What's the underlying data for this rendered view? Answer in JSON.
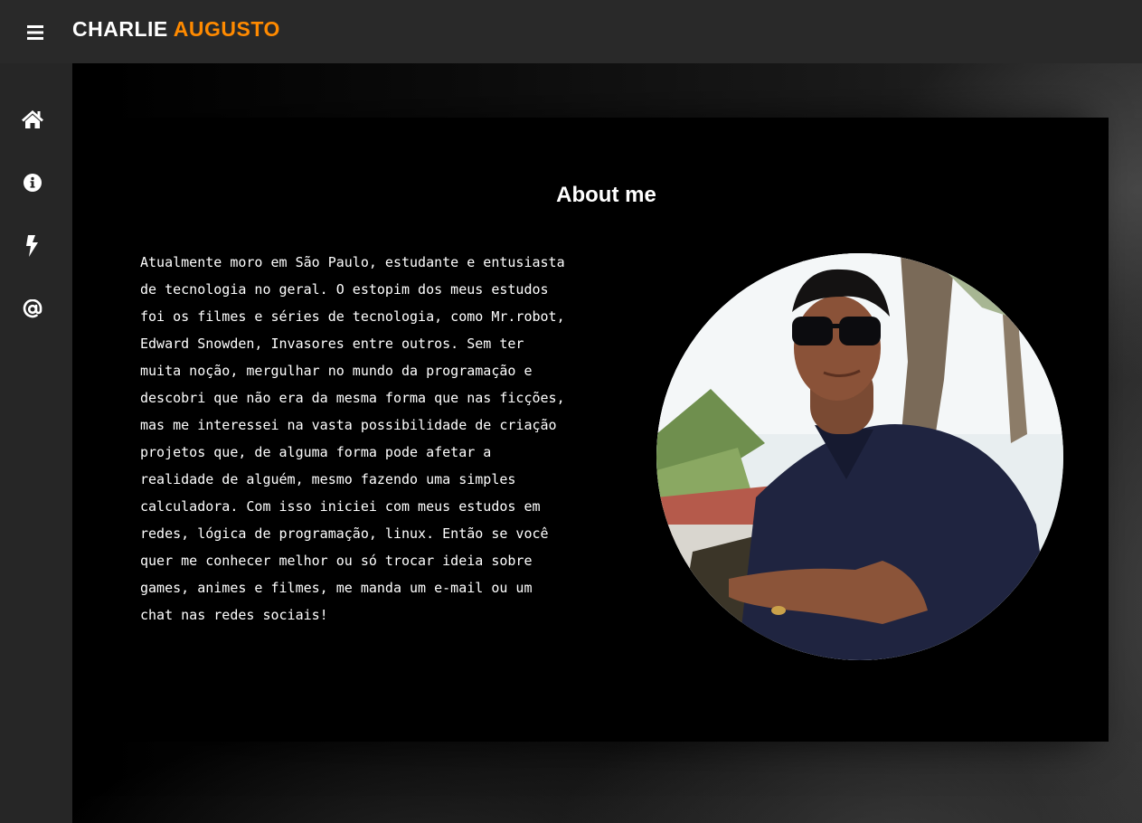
{
  "header": {
    "menu_icon": "hamburger-icon",
    "brand_first": "CHARLIE",
    "brand_second": "AUGUSTO",
    "brand_accent_color": "#ff8a00"
  },
  "sidebar": {
    "items": [
      {
        "icon": "home-icon"
      },
      {
        "icon": "info-icon"
      },
      {
        "icon": "bolt-icon"
      },
      {
        "icon": "at-icon"
      }
    ]
  },
  "about": {
    "title": "About me",
    "text": "Atualmente moro em São Paulo, estudante e entusiasta de tecnologia no geral. O estopim dos meus estudos foi os filmes e séries de tecnologia, como Mr.robot, Edward Snowden, Invasores entre outros. Sem ter muita noção, mergulhar no mundo da programação e descobri que não era da mesma forma que nas ficções, mas me interessei na vasta possibilidade de criação projetos que, de alguma forma pode afetar a realidade de alguém, mesmo fazendo uma simples calculadora. Com isso iniciei com meus estudos em redes, lógica de programação, linux. Então se você quer me conhecer melhor ou só trocar ideia sobre games, animes e filmes, me manda um e-mail ou um chat nas redes sociais!"
  }
}
